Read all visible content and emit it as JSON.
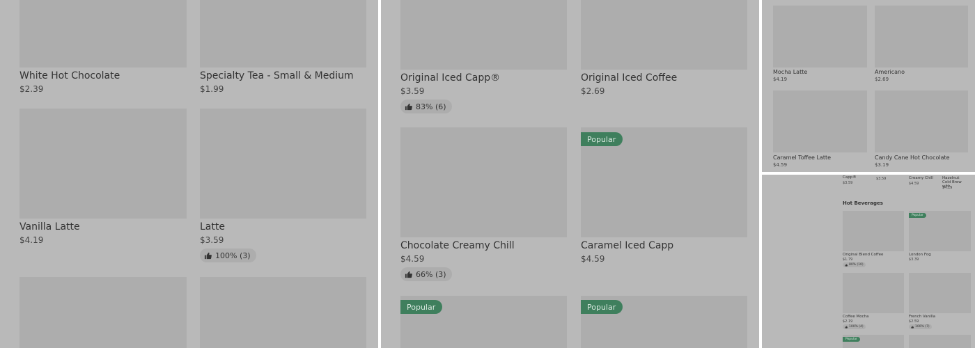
{
  "panels": {
    "p1": {
      "items": [
        {
          "name": "White Hot Chocolate",
          "price": "$2.39"
        },
        {
          "name": "Specialty Tea - Small & Medium",
          "price": "$1.99"
        },
        {
          "name": "Vanilla Latte",
          "price": "$4.19"
        },
        {
          "name": "Latte",
          "price": "$3.59",
          "rating": "100% (3)"
        }
      ]
    },
    "p2": {
      "items": [
        {
          "name": "Original Iced Capp®",
          "price": "$3.59",
          "rating": "83% (6)"
        },
        {
          "name": "Original Iced Coffee",
          "price": "$2.69"
        },
        {
          "name": "Chocolate Creamy Chill",
          "price": "$4.59",
          "rating": "66% (3)"
        },
        {
          "name": "Caramel Iced Capp",
          "price": "$4.59",
          "badge": "Popular"
        }
      ],
      "row3_badges": [
        "Popular",
        "Popular"
      ]
    },
    "p3": {
      "items": [
        {
          "name": "Mocha Latte",
          "price": "$4.19"
        },
        {
          "name": "Americano",
          "price": "$2.69"
        },
        {
          "name": "Caramel Toffee Latte",
          "price": "$4.59"
        },
        {
          "name": "Candy Cane Hot Chocolate",
          "price": "$3.19"
        }
      ]
    },
    "p4": {
      "top_row": [
        {
          "name": "Capp®",
          "price": "$3.59"
        },
        {
          "name": "",
          "price": "$3.59"
        },
        {
          "name": "Creamy Chill",
          "price": "$4.59"
        },
        {
          "name": "Hazelnut Cold Brew with",
          "price": "$4.19"
        }
      ],
      "section_title": "Hot Beverages",
      "items": [
        {
          "name": "Original Blend Coffee",
          "price": "$1.79",
          "rating": "80% (10)"
        },
        {
          "name": "London Fog",
          "price": "$3.39",
          "badge": "Popular"
        },
        {
          "name": "Coffee Mocha",
          "price": "$2.19",
          "rating": "100% (4)"
        },
        {
          "name": "French Vanilla",
          "price": "$2.59",
          "rating": "100% (7)"
        }
      ],
      "row3_badge": "Popular"
    }
  },
  "colors": {
    "overlay": "#b9b9b9",
    "image_placeholder": "#adadad",
    "popular_badge": "#3f7f5d"
  },
  "icons": {
    "rating": "thumbs-up-icon"
  }
}
